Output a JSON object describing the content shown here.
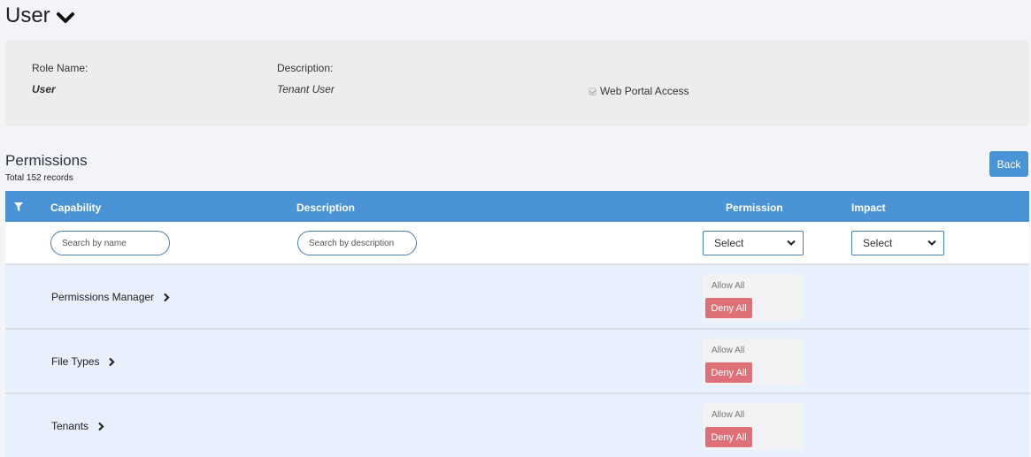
{
  "header": {
    "title": "User"
  },
  "role": {
    "name_label": "Role Name:",
    "name_value": "User",
    "description_label": "Description:",
    "description_value": "Tenant User",
    "web_portal_label": "Web Portal Access",
    "web_portal_checked": true
  },
  "permissions": {
    "title": "Permissions",
    "count": "Total 152 records",
    "back_label": "Back",
    "columns": {
      "capability": "Capability",
      "description": "Description",
      "permission": "Permission",
      "impact": "Impact"
    },
    "filters": {
      "name_placeholder": "Search by name",
      "description_placeholder": "Search by description",
      "permission_select": "Select",
      "impact_select": "Select"
    },
    "rows": [
      {
        "name": "Permissions Manager",
        "allow": "Allow All",
        "deny": "Deny All"
      },
      {
        "name": "File Types",
        "allow": "Allow All",
        "deny": "Deny All"
      },
      {
        "name": "Tenants",
        "allow": "Allow All",
        "deny": "Deny All"
      }
    ]
  },
  "colors": {
    "accent": "#4a94d6",
    "deny": "#e07078",
    "row_bg": "#e8effd"
  }
}
